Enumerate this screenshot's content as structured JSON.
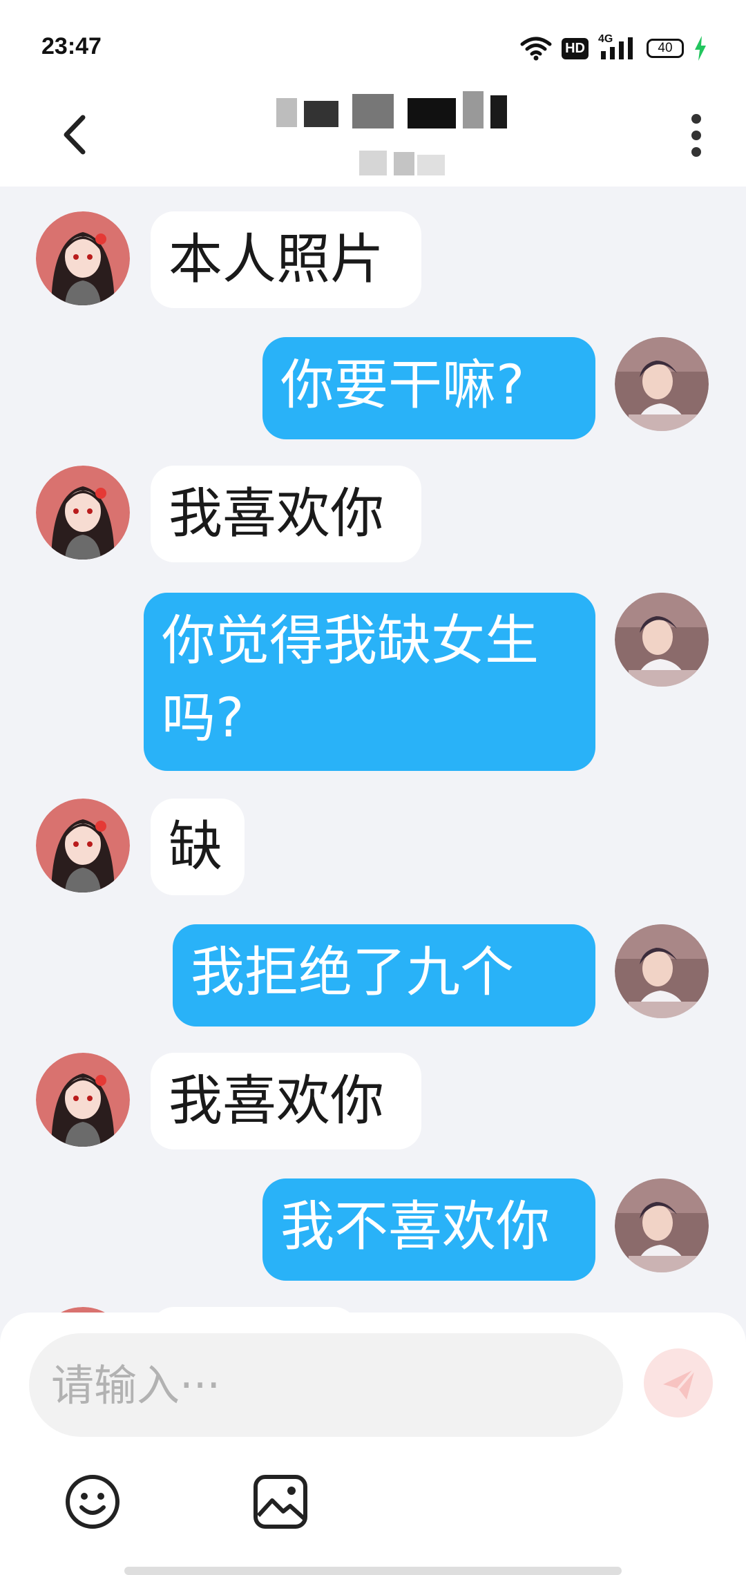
{
  "status_bar": {
    "time": "23:47",
    "hd_label": "HD",
    "network_label": "4G",
    "battery_level": "40",
    "colors": {
      "charging": "#22c55e"
    }
  },
  "header": {
    "back_icon": "chevron-left-icon",
    "more_icon": "more-vertical-icon"
  },
  "messages": [
    {
      "side": "received",
      "text": "本人照片"
    },
    {
      "side": "sent",
      "text": "你要干嘛?"
    },
    {
      "side": "received",
      "text": "我喜欢你"
    },
    {
      "side": "sent",
      "text": "你觉得我缺女生吗?"
    },
    {
      "side": "received",
      "text": "缺"
    },
    {
      "side": "sent",
      "text": "我拒绝了九个"
    },
    {
      "side": "received",
      "text": "我喜欢你"
    },
    {
      "side": "sent",
      "text": "我不喜欢你"
    }
  ],
  "input": {
    "placeholder": "请输入···",
    "value": "",
    "send_icon": "send-icon",
    "emoji_icon": "emoji-icon",
    "image_icon": "image-icon"
  },
  "colors": {
    "sent_bubble": "#29b2f8",
    "received_bubble": "#ffffff",
    "chat_background": "#f2f3f7"
  }
}
